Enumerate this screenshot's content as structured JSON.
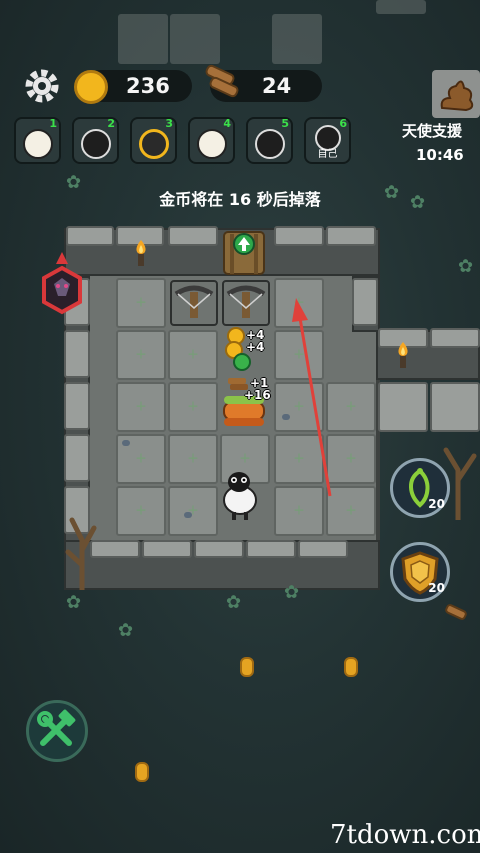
{
  "hud": {
    "coins": "236",
    "wood": "24",
    "countdown_message": "金币将在 16 秒后掉落",
    "angel_support_label": "天使支援",
    "timer": "10:46"
  },
  "players": [
    {
      "index": "1",
      "label": ""
    },
    {
      "index": "2",
      "label": ""
    },
    {
      "index": "3",
      "label": ""
    },
    {
      "index": "4",
      "label": ""
    },
    {
      "index": "5",
      "label": ""
    },
    {
      "index": "6",
      "label": "自己"
    }
  ],
  "floating": {
    "a": "+4",
    "b": "+4",
    "c": "+1",
    "d": "+16"
  },
  "abilities": {
    "thorn_count": "20",
    "shield_count": "20"
  },
  "watermark": "7tdown.com",
  "colors": {
    "gold": "#f2b61d",
    "green_badge": "#3be04a",
    "arrow_red": "#e0413a"
  }
}
